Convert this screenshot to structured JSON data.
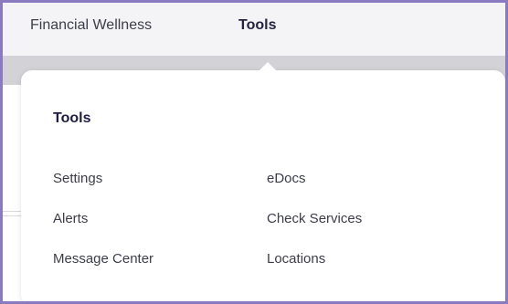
{
  "nav": {
    "financial_wellness": "Financial Wellness",
    "tools": "Tools"
  },
  "dropdown": {
    "title": "Tools",
    "left_items": [
      "Settings",
      "Alerts",
      "Message Center"
    ],
    "right_items": [
      "eDocs",
      "Check Services",
      "Locations"
    ]
  },
  "colors": {
    "frame_border": "#8a7bc0",
    "nav_background": "#f4f4f6",
    "band_gray": "#d3d3d7",
    "title_navy": "#1f1d44",
    "text_gray": "#3d3d4a"
  }
}
